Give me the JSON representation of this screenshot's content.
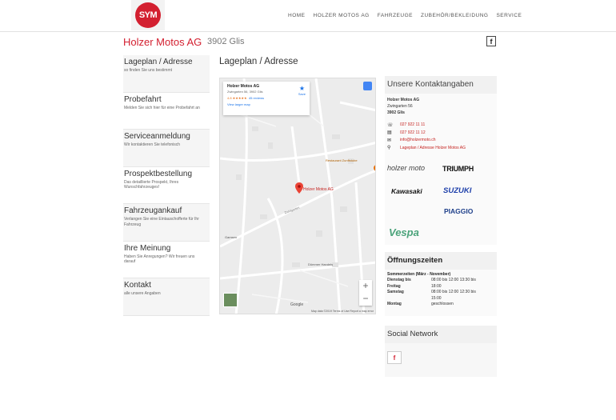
{
  "header": {
    "logo_text": "SYM",
    "nav": [
      "HOME",
      "HOLZER MOTOS AG",
      "FAHRZEUGE",
      "ZUBEHÖR/BEKLEIDUNG",
      "SERVICE"
    ]
  },
  "brand": {
    "name": "Holzer Motos AG",
    "city": "3902 Glis",
    "accent": "#d32030"
  },
  "sidebar": {
    "items": [
      {
        "title": "Lageplan / Adresse",
        "desc": "so finden Sie uns bestimmt"
      },
      {
        "title": "Probefahrt",
        "desc": "Melden Sie sich hier für eine Probefahrt an"
      },
      {
        "title": "Serviceanmeldung",
        "desc": "Wir kontaktieren Sie telefonisch"
      },
      {
        "title": "Prospektbestellung",
        "desc": "Das detaillierte Prospekt, Ihres Wunschfahrzeuges!"
      },
      {
        "title": "Fahrzeugankauf",
        "desc": "Verlangen Sie eine Eintauschofferte für Ihr Fahrzeug"
      },
      {
        "title": "Ihre Meinung",
        "desc": "Haben Sie Anregungen? Wir freuen uns darauf"
      },
      {
        "title": "Kontakt",
        "desc": "alle unsere Angaben"
      }
    ]
  },
  "main": {
    "title": "Lageplan / Adresse"
  },
  "map": {
    "card_name": "Holzer Motos AG",
    "card_address": "Zwingarten 56, 3902 Glis",
    "card_rating": "4.8 ★★★★★",
    "card_reviews": "45 reviews",
    "card_link": "View larger map",
    "save_label": "Save",
    "pin_label": "Holzer Motos AG",
    "attribution": "Map data ©2019   Terms of Use   Report a map error",
    "google": "Google",
    "street_labels": [
      "Restaurant Zunftstube",
      "Gamsen",
      "Dümmer Handels",
      "Glis",
      "Zwingarten"
    ]
  },
  "contact": {
    "heading": "Unsere Kontaktangaben",
    "company": "Holzer Motos AG",
    "street": "Zwingarten 56",
    "city": "3902  Glis",
    "phone": "027 922 11 11",
    "fax": "027 922 11 12",
    "email": "info@holzermoto.ch",
    "location_link": "Lageplan / Adresse Holzer Motos AG",
    "icons": [
      "phone-icon",
      "fax-icon",
      "mail-icon",
      "location-icon"
    ]
  },
  "brands": [
    "holzer moto",
    "TRIUMPH",
    "Kawasaki",
    "SUZUKI",
    "PIAGGIO",
    "Vespa"
  ],
  "hours": {
    "heading": "Öffnungszeiten",
    "season": "Sommerzeiten  (März - November)",
    "rows": [
      {
        "day": "Dienstag bis",
        "time": "08:00 bis 12:00 13:30 bis"
      },
      {
        "day": "Freitag",
        "time": "18:00"
      },
      {
        "day": "Samstag",
        "time": "08:00 bis 12:00 12:30 bis"
      },
      {
        "day": "",
        "time": "15:00"
      },
      {
        "day": "Montag",
        "time": "geschlossen"
      }
    ]
  },
  "social": {
    "heading": "Social Network",
    "fb_glyph": "f"
  }
}
